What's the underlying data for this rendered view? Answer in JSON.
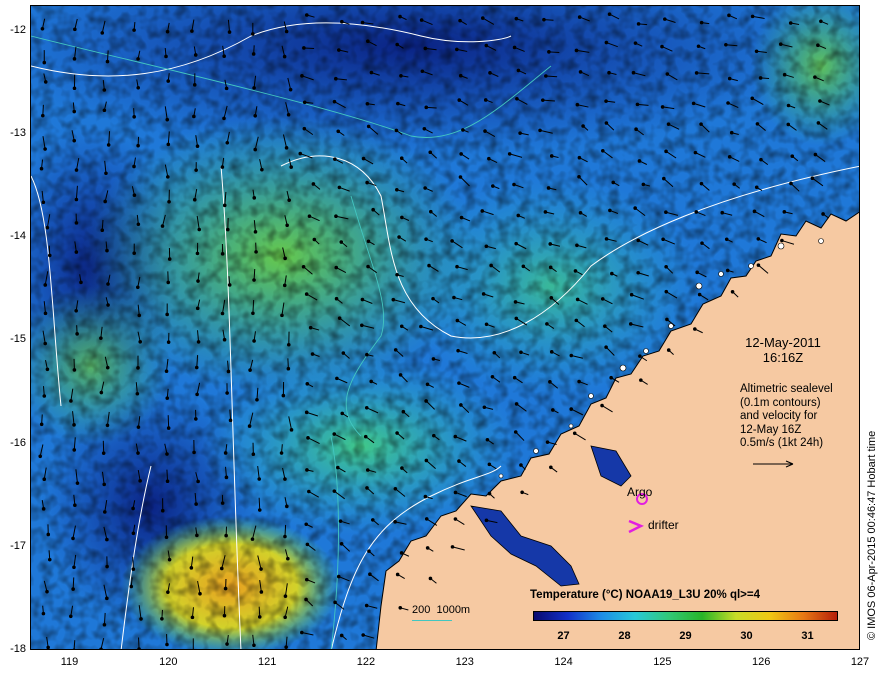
{
  "map": {
    "lat_ticks": [
      "-12",
      "-13",
      "-14",
      "-15",
      "-16",
      "-17",
      "-18"
    ],
    "lon_ticks": [
      "119",
      "120",
      "121",
      "122",
      "123",
      "124",
      "125",
      "126",
      "127"
    ],
    "lat_range": [
      -18,
      -11.75
    ],
    "lon_range": [
      118.6,
      127
    ]
  },
  "annotations": {
    "date": "12-May-2011",
    "time": "16:16Z",
    "sealevel_lines": [
      "Altimetric sealevel",
      "(0.1m contours)",
      "and velocity for",
      "12-May 16Z",
      "0.5m/s (1kt 24h)"
    ],
    "argo_label": "Argo",
    "drifter_label": "drifter",
    "depth_contours_label": "200  1000m"
  },
  "colorbar": {
    "title": "Temperature (°C) NOAA19_L3U 20% ql>=4",
    "ticks": [
      "27",
      "28",
      "29",
      "30",
      "31"
    ],
    "range": [
      26.5,
      31.5
    ],
    "colors": [
      "#0a0a6e",
      "#1230c8",
      "#1e8ce6",
      "#28c8d8",
      "#32c878",
      "#28b428",
      "#c8dc28",
      "#f0c814",
      "#e87814",
      "#b41e0a"
    ]
  },
  "credit": "© IMOS 06-Apr-2015 00:46:47 Hobart time",
  "colors": {
    "land": "#f6c9a2",
    "deep_sst": "#0d2f9e",
    "mid_sst": "#1f8ee0",
    "warm_sst": "#3bbf6a",
    "argo_marker": "#e21fe0",
    "contour_white": "#ffffff",
    "contour_cyan": "#43c6c0"
  }
}
